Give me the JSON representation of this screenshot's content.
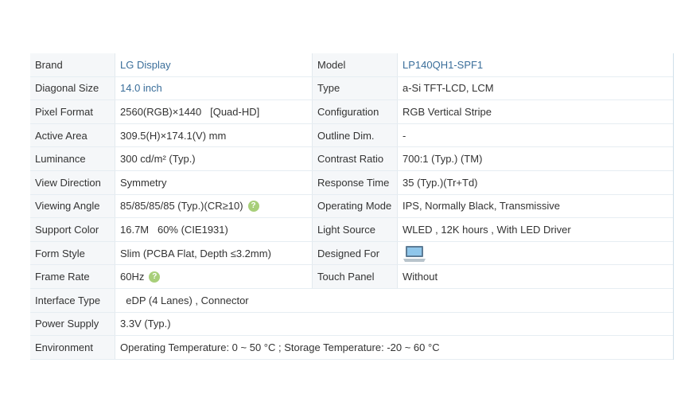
{
  "rows": [
    {
      "l1": "Brand",
      "v1": "LG Display",
      "l2": "Model",
      "v2": "LP140QH1-SPF1"
    },
    {
      "l1": "Diagonal Size",
      "v1": "14.0 inch",
      "l2": "Type",
      "v2": "a-Si TFT-LCD, LCM"
    },
    {
      "l1": "Pixel Format",
      "v1": "2560(RGB)×1440   [Quad-HD]",
      "l2": "Configuration",
      "v2": "RGB Vertical Stripe"
    },
    {
      "l1": "Active Area",
      "v1": "309.5(H)×174.1(V) mm",
      "l2": "Outline Dim.",
      "v2": "-"
    },
    {
      "l1": "Luminance",
      "v1": "300 cd/m² (Typ.)",
      "l2": "Contrast Ratio",
      "v2": "700:1 (Typ.) (TM)"
    },
    {
      "l1": "View Direction",
      "v1": "Symmetry",
      "l2": "Response Time",
      "v2": "35 (Typ.)(Tr+Td)"
    },
    {
      "l1": "Viewing Angle",
      "v1": "85/85/85/85 (Typ.)(CR≥10)",
      "l2": "Operating Mode",
      "v2": "IPS, Normally Black, Transmissive"
    },
    {
      "l1": "Support Color",
      "v1": "16.7M   60% (CIE1931)",
      "l2": "Light Source",
      "v2": "WLED , 12K hours , With LED Driver"
    },
    {
      "l1": "Form Style",
      "v1": "Slim (PCBA Flat, Depth ≤3.2mm)",
      "l2": "Designed For",
      "v2": ""
    },
    {
      "l1": "Frame Rate",
      "v1": "60Hz",
      "l2": "Touch Panel",
      "v2": "Without"
    },
    {
      "l1": "Interface Type",
      "vfull": "  eDP (4 Lanes) , Connector"
    },
    {
      "l1": "Power Supply",
      "vfull": "3.3V (Typ.)"
    },
    {
      "l1": "Environment",
      "vfull": "Operating Temperature: 0 ~ 50 °C ; Storage Temperature: -20 ~ 60 °C"
    }
  ],
  "help_icon_glyph": "?",
  "designed_for_icon": "laptop-icon",
  "link_color": "#3a6e9a",
  "help_color": "#a8cf7a"
}
